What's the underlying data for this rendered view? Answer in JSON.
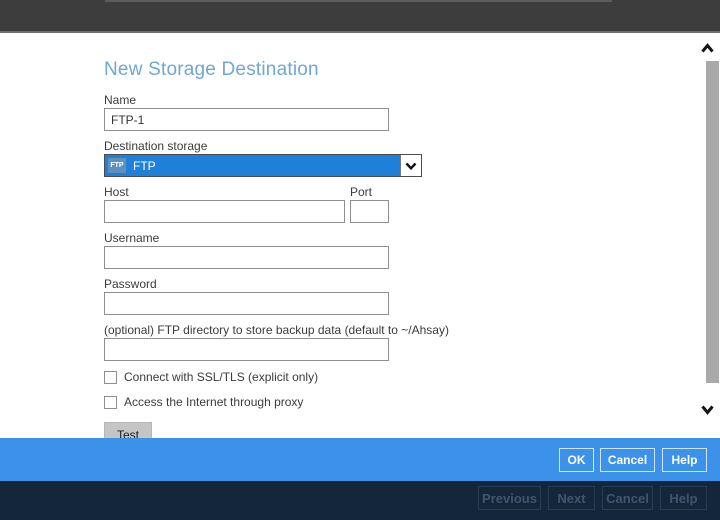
{
  "colors": {
    "topbar": "#3d3d3d",
    "title": "#6fa7d3",
    "dropdown_selected_bg": "#1e80d8",
    "dropdown_badge_bg": "#5c90bf",
    "action_bar": "#3b92e8",
    "wizard_bar": "#142639"
  },
  "dialog": {
    "title": "New Storage Destination",
    "name_field": {
      "label": "Name",
      "value": "FTP-1"
    },
    "destination_storage": {
      "label": "Destination storage",
      "selected_option": "FTP",
      "badge": "FTP"
    },
    "host_field": {
      "label": "Host",
      "value": ""
    },
    "port_field": {
      "label": "Port",
      "value": ""
    },
    "username_field": {
      "label": "Username",
      "value": ""
    },
    "password_field": {
      "label": "Password",
      "value": ""
    },
    "directory_field": {
      "label": "(optional) FTP directory to store backup data (default to ~/Ahsay)",
      "value": ""
    },
    "checkboxes": [
      {
        "label": "Connect with SSL/TLS (explicit only)",
        "checked": false
      },
      {
        "label": "Access the Internet through proxy",
        "checked": false
      }
    ],
    "test_button_label": "Test",
    "ok_label": "OK",
    "cancel_label": "Cancel",
    "help_label": "Help"
  },
  "wizard_footer": {
    "previous_label": "Previous",
    "next_label": "Next",
    "cancel_label": "Cancel",
    "help_label": "Help"
  },
  "icons": {
    "dropdown_button": "chevron-down-icon",
    "scroll_up": "chevron-up-icon",
    "scroll_down": "chevron-down-icon"
  }
}
